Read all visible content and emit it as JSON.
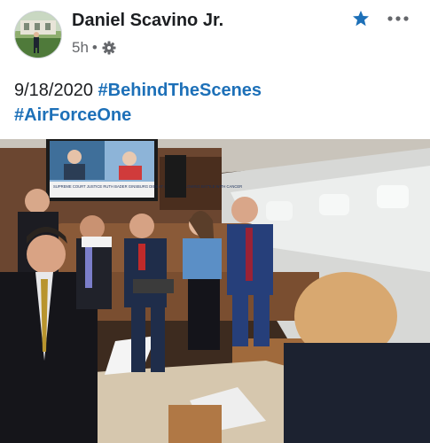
{
  "post": {
    "author": "Daniel Scavino Jr.",
    "timestamp": "5h",
    "separator": "•",
    "privacy_icon": "gear-icon",
    "text_date": "9/18/2020",
    "hashtags": [
      "#BehindTheScenes",
      "#AirForceOne"
    ]
  },
  "actions": {
    "favorite_icon": "star-icon",
    "more_icon": "more-options-icon"
  },
  "tv": {
    "ticker": "SUPREME COURT JUSTICE RUTH BADER GINSBURG DIES AT AGE 87 FOLLOWING BATTLE WITH CANCER"
  },
  "colors": {
    "hashtag": "#1d70b8",
    "star": "#1d70b8",
    "meta": "#65676b"
  }
}
